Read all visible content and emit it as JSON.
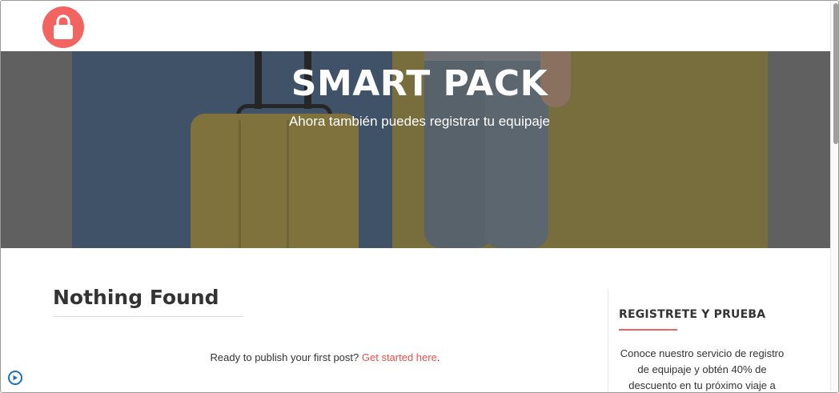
{
  "header": {
    "logo_icon": "padlock-icon",
    "brand_color": "#f26462"
  },
  "hero": {
    "title": "SMART PACK",
    "subtitle": "Ahora también puedes registrar tu equipaje"
  },
  "main": {
    "page_title": "Nothing Found",
    "notice_text": "Ready to publish your first post? ",
    "notice_link": "Get started here",
    "notice_end": "."
  },
  "sidebar": {
    "widget_title": "REGISTRETE Y PRUEBA",
    "widget_text": "Conoce nuestro servicio de registro de equipaje y obtén 40% de descuento en tu próximo viaje a"
  },
  "floating": {
    "play_icon": "play-circle-icon",
    "accent_color": "#1e6fb8"
  }
}
